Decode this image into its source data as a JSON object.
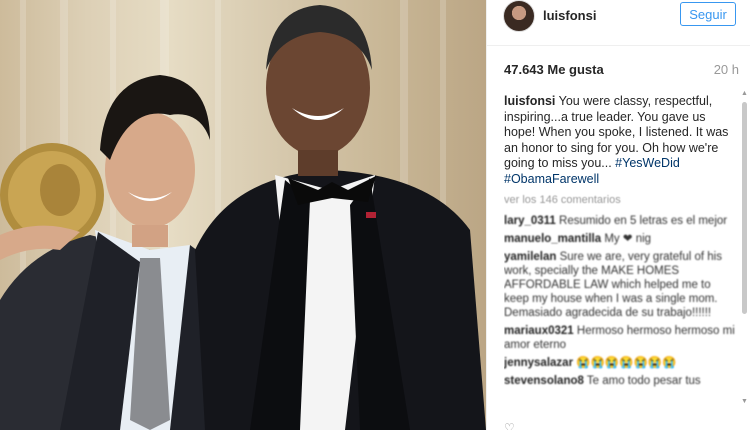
{
  "photo": {
    "description_icon": "portrait-photo"
  },
  "header": {
    "username": "luisfonsi",
    "follow_label": "Seguir"
  },
  "stats": {
    "likes": "47.643 Me gusta",
    "time": "20 h"
  },
  "caption": {
    "author": "luisfonsi",
    "text": " You were classy, respectful, inspiring...a true leader. You gave us hope! When you spoke, I listened. It was an honor to sing for you. Oh how we're going to miss you... ",
    "tags": "#YesWeDid #ObamaFarewell"
  },
  "view_all": "ver los 146 comentarios",
  "comments": [
    {
      "user": "lary_0311",
      "text": " Resumido en 5 letras es el mejor"
    },
    {
      "user": "manuelo_mantilla",
      "text": " My ❤ nig"
    },
    {
      "user": "yamilelan",
      "text": " Sure we are, very grateful of his work, specially the MAKE HOMES AFFORDABLE LAW which helped me to keep my house when I was a single mom. Demasiado agradecida de su trabajo!!!!!!"
    },
    {
      "user": "mariaux0321",
      "text": " Hermoso hermoso hermoso mi amor eterno"
    },
    {
      "user": "jennysalazar",
      "text": " 😭😭😭😭😭😭😭"
    },
    {
      "user": "stevensolano8",
      "text": " Te amo todo pesar tus"
    }
  ],
  "colors": {
    "follow_blue": "#3897f0",
    "hashtag": "#003569",
    "muted": "#999999"
  }
}
